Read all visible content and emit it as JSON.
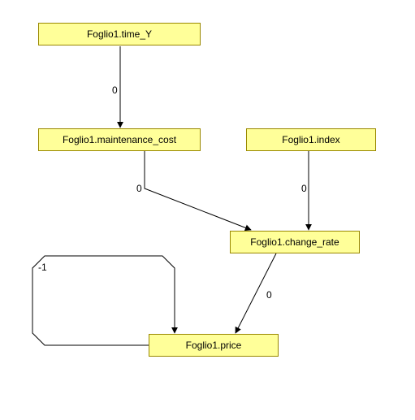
{
  "nodes": {
    "time_y": {
      "label": "Foglio1.time_Y"
    },
    "maintenance_cost": {
      "label": "Foglio1.maintenance_cost"
    },
    "index": {
      "label": "Foglio1.index"
    },
    "change_rate": {
      "label": "Foglio1.change_rate"
    },
    "price": {
      "label": "Foglio1.price"
    }
  },
  "edges": {
    "time_to_maint": {
      "label": "0"
    },
    "maint_to_change": {
      "label": "0"
    },
    "index_to_change": {
      "label": "0"
    },
    "change_to_price": {
      "label": "0"
    },
    "price_self": {
      "label": "-1"
    }
  }
}
